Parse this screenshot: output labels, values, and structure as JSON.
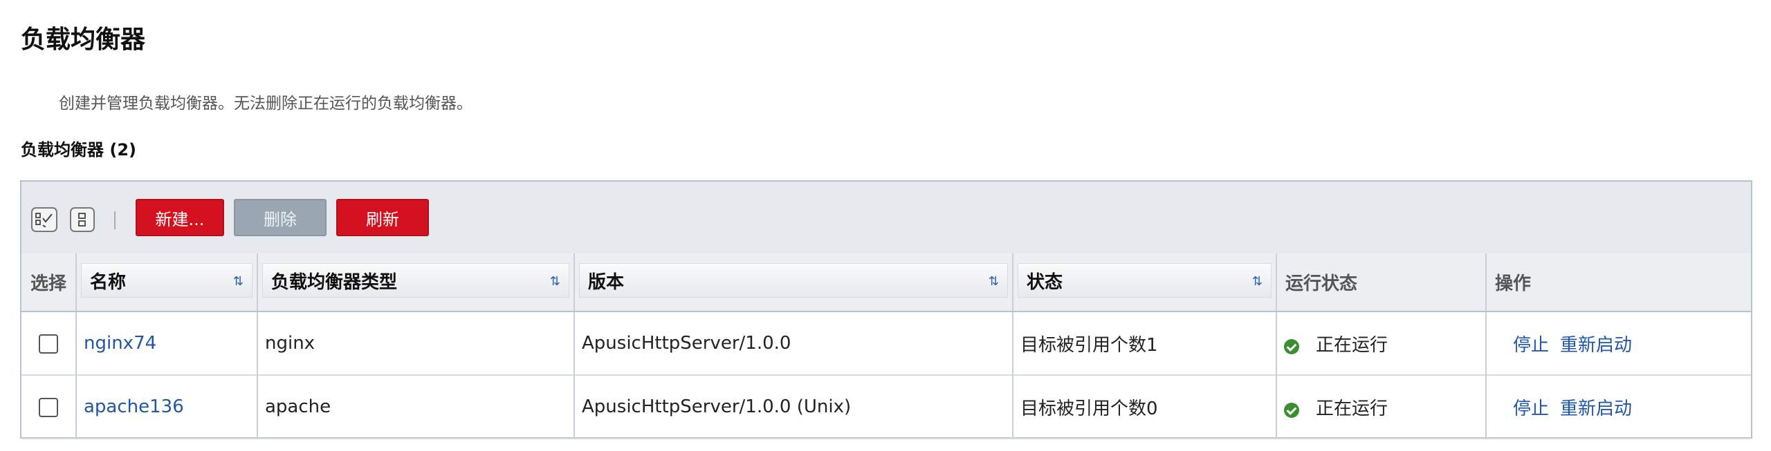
{
  "page": {
    "title": "负载均衡器",
    "description": "创建并管理负载均衡器。无法删除正在运行的负载均衡器。",
    "section_title": "负载均衡器 (2)"
  },
  "toolbar": {
    "new_label": "新建...",
    "delete_label": "删除",
    "refresh_label": "刷新"
  },
  "table": {
    "columns": {
      "select": "选择",
      "name": "名称",
      "type": "负载均衡器类型",
      "version": "版本",
      "status": "状态",
      "run_status": "运行状态",
      "actions": "操作"
    },
    "sort_icon": "⇅",
    "rows": [
      {
        "name": "nginx74",
        "type": "nginx",
        "version": "ApusicHttpServer/1.0.0",
        "status": "目标被引用个数1",
        "run_status": "正在运行",
        "action_stop": "停止",
        "action_restart": "重新启动"
      },
      {
        "name": "apache136",
        "type": "apache",
        "version": "ApusicHttpServer/1.0.0 (Unix)",
        "status": "目标被引用个数0",
        "run_status": "正在运行",
        "action_stop": "停止",
        "action_restart": "重新启动"
      }
    ]
  },
  "colors": {
    "accent_red": "#d4121f",
    "disabled_grey": "#9aa7b2",
    "link_blue": "#1f56a5",
    "ok_green": "#3a8f2f"
  },
  "icons": [
    "select-all-icon",
    "deselect-all-icon",
    "sort-icon",
    "running-status-icon"
  ]
}
